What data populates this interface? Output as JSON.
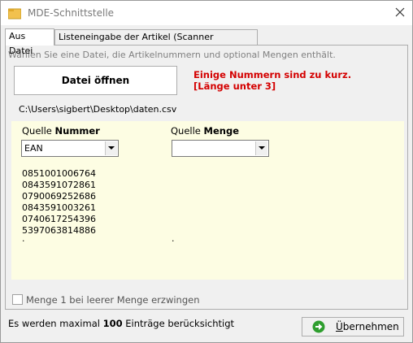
{
  "window": {
    "title": "MDE-Schnittstelle"
  },
  "tabs": [
    {
      "label": "Aus Datei",
      "active": true
    },
    {
      "label": "Listeneingabe der Artikel (Scanner möglich)",
      "active": false
    }
  ],
  "file_tab": {
    "hint": "Wählen Sie eine Datei, die Artikelnummern und optional Mengen enthält.",
    "open_button_label": "Datei öffnen",
    "error_lines": [
      "Einige Nummern sind zu kurz.",
      "[Länge unter 3]"
    ],
    "file_path": "C:\\Users\\sigbert\\Desktop\\daten.csv",
    "number_source": {
      "label_prefix": "Quelle ",
      "label_bold": "Nummer",
      "selected": "EAN"
    },
    "quantity_source": {
      "label_prefix": "Quelle ",
      "label_bold": "Menge",
      "selected": ""
    },
    "numbers": [
      "0851001006764",
      "0843591072861",
      "0790069252686",
      "0843591003261",
      "0740617254396",
      "5397063814886",
      "."
    ],
    "quantities": [
      "."
    ],
    "force_quantity_checkbox": {
      "label": "Menge 1 bei leerer Menge erzwingen",
      "checked": false
    }
  },
  "footer": {
    "text_before": "Es werden maximal ",
    "max_count": "100",
    "text_after": " Einträge berücksichtigt",
    "accept_button_first_letter": "Ü",
    "accept_button_rest": "bernehmen"
  },
  "colors": {
    "error": "#d40000",
    "data_area_bg": "#fdfde3",
    "accept_icon": "#2e9e2e"
  }
}
